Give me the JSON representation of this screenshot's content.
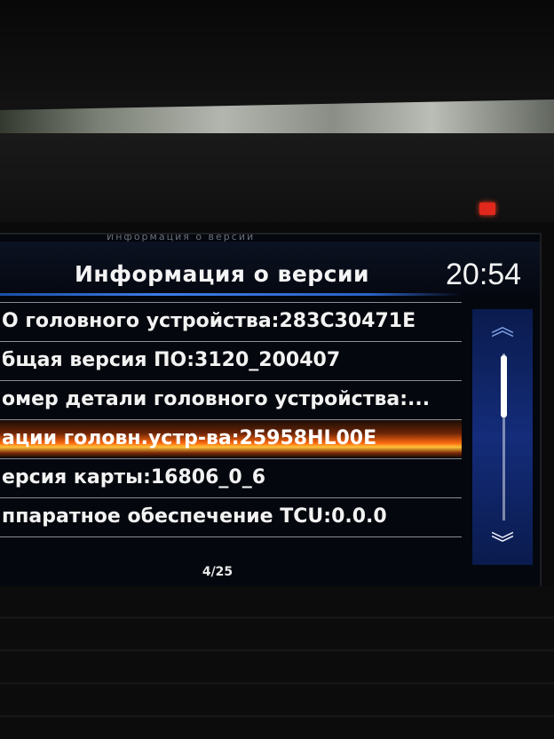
{
  "screen": {
    "previous_title_ghost": "Информация о версии",
    "title": "Информация о версии",
    "clock": "20:54",
    "items": [
      {
        "label": "О головного устройства:283C30471E"
      },
      {
        "label": "бщая версия ПО:3120_200407"
      },
      {
        "label": "омер детали головного устройства:..."
      },
      {
        "label": "ации головн.устр-ва:25958HL00E",
        "selected": true
      },
      {
        "label": "ерсия карты:16806_0_6"
      },
      {
        "label": "ппаратное обеспечение TCU:0.0.0"
      }
    ],
    "pager": "4/25",
    "scroll_up_icon": "double-chevron-up",
    "scroll_down_icon": "double-chevron-down"
  },
  "colors": {
    "accent_blue": "#2a63c8",
    "selection_orange": "#ff6a10",
    "text": "#f2f2f2"
  }
}
